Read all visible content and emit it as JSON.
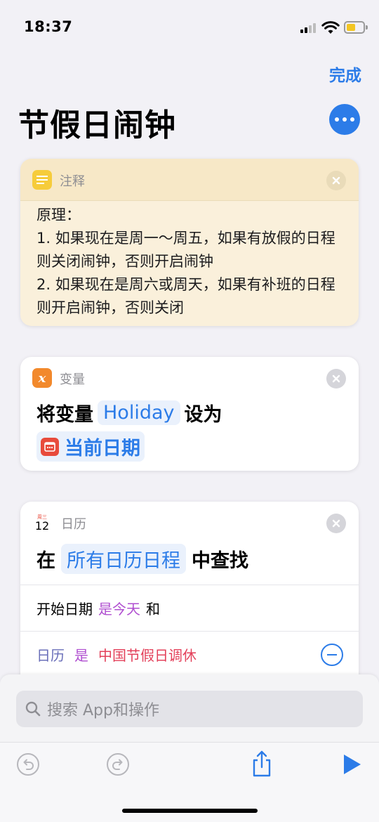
{
  "status_bar": {
    "time": "18:37"
  },
  "header": {
    "done_label": "完成",
    "title": "节假日闹钟"
  },
  "comment_card": {
    "kind": "注释",
    "text": "原理：\n1. 如果现在是周一～周五，如果有放假的日程则关闭闹钟，否则开启闹钟\n2. 如果现在是周六或周天，如果有补班的日程则开启闹钟，否则关闭"
  },
  "variable_card": {
    "kind": "变量",
    "prefix": "将变量",
    "variable_name": "Holiday",
    "suffix": "设为",
    "value": "当前日期"
  },
  "calendar_card": {
    "kind": "日历",
    "icon_weekday": "周三",
    "icon_day": "12",
    "prefix": "在",
    "source": "所有日历日程",
    "suffix": "中查找",
    "filter1": {
      "field": "开始日期",
      "condition": "是今天",
      "joiner": "和"
    },
    "filter2": {
      "field": "日历",
      "operator": "是",
      "value": "中国节假日调休"
    }
  },
  "search": {
    "placeholder": "搜索 App和操作"
  },
  "colors": {
    "accent": "#2c7ce8",
    "comment_bg": "#faf0db",
    "variable_icon": "#f2892c",
    "calendar_red": "#e84b3c",
    "purple": "#b04fd0"
  },
  "icons": {
    "comment": "note-lines-icon",
    "variable": "x-variable-icon",
    "calendar": "calendar-icon",
    "undo": "undo-icon",
    "redo": "redo-icon",
    "share": "share-icon",
    "run": "play-icon",
    "search": "magnifier-icon"
  }
}
